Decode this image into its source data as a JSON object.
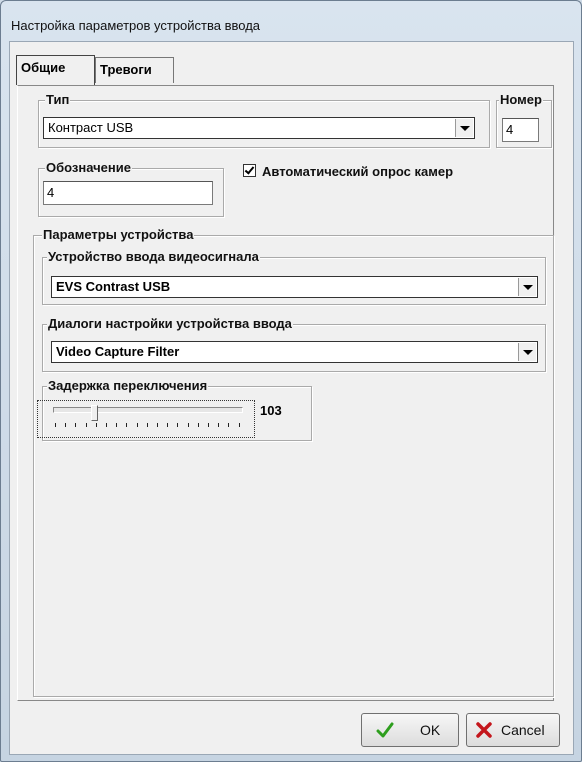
{
  "window": {
    "title": "Настройка параметров устройства ввода"
  },
  "tabs": [
    {
      "label": "Общие"
    },
    {
      "label": "Тревоги"
    }
  ],
  "type_group": {
    "label": "Тип",
    "value": "Контраст USB"
  },
  "number_group": {
    "label": "Номер",
    "value": "4"
  },
  "designation_group": {
    "label": "Обозначение",
    "value": "4"
  },
  "auto_poll": {
    "label": "Автоматический опрос камер",
    "checked": true
  },
  "device_params": {
    "label": "Параметры устройства",
    "video_input": {
      "label": "Устройство ввода видеосигнала",
      "value": "EVS Contrast USB"
    },
    "dialogs": {
      "label": "Диалоги настройки устройства ввода",
      "value": "Video Capture Filter"
    },
    "delay": {
      "label": "Задержка переключения",
      "value": "103"
    }
  },
  "buttons": {
    "ok": "OK",
    "cancel": "Cancel"
  },
  "colors": {
    "ok_check": "#2e9e1e",
    "cancel_x": "#c4161c"
  }
}
